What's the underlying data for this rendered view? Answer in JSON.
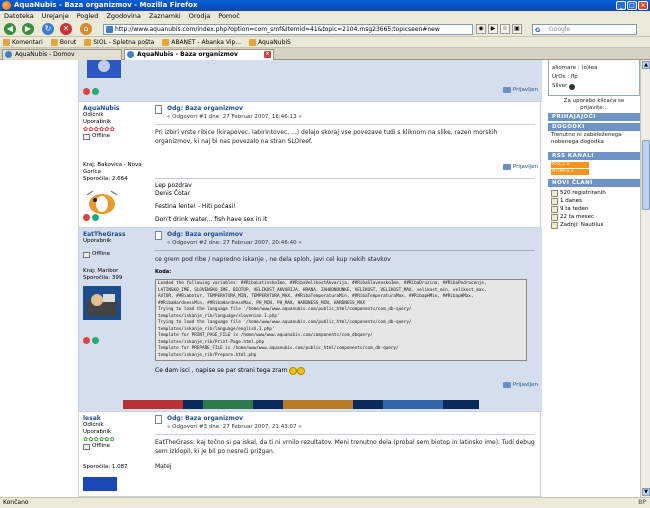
{
  "window": {
    "title": "AquaNubis - Baza organizmov - Mozilla Firefox"
  },
  "menubar": [
    "Datoteka",
    "Urejanje",
    "Pogled",
    "Zgodovina",
    "Zaznamki",
    "Orodja",
    "Pomoč"
  ],
  "navbar": {
    "url": "http://www.aquanubis.com/index.php?option=com_smf&Itemid=41&topic=2104.msg23665;topicseen#new",
    "search_placeholder": "Google",
    "search_logo": "G"
  },
  "bookmarks": [
    "Komentari",
    "Borut",
    "SIOL - Spletna pošta",
    "ABANET - Abanka Vip...",
    "AquaNubiS"
  ],
  "tabs": [
    {
      "label": "AquaNubis - Domov"
    },
    {
      "label": "AquaNubis - Baza organizmov"
    }
  ],
  "posts": [
    {
      "reply": "Prijavljen"
    },
    {
      "user": "AquaNubis",
      "rank": "Odičnik",
      "role": "Uporabnik",
      "stars": "✿✿✿✿✿✿",
      "status": "Offline",
      "location": "Kraj: Bakovica - Nova Gorica",
      "messages": "Sporočila: 2.664",
      "title": "Odg: Baza organizmov",
      "meta": "« Odgovori #1 dne: 27 Februar 2007, 16:46:13 »",
      "text": "Pri izbiri vrste ribice (kirapovec, labirintovec, ...) delajo skoraj vse povezave tudi s kliknom na slike, razen morskih organizmov, ki naj bi nas povezalo na stran SLOreef.",
      "sig1": "Lep pozdrav",
      "sig2": "Denis Čotar",
      "sig3": "Festina lente! - Hiti počasi!",
      "sig4": "Don't drink water... fish have sex in it",
      "reply": "Prijavljen"
    },
    {
      "user": "EatTheGrass",
      "role": "Uporabnik",
      "status": "Offline",
      "location": "Kraj: Maribor",
      "messages": "Sporočila: 399",
      "title": "Odg: Baza organizmov",
      "meta": "« Odgovori #2 dne: 27 Februar 2007, 20:46:40 »",
      "text": "ce grem pod ribe / napredno iskanje , ne dela sploh, javi cel kup nekih stavkov",
      "code_label": "Koda:",
      "code": "Loaded the following variables: ##RibaLatinskoIme, ##RibaVelikostAkvarija, ##RibaSlovenskoIme, ##RibaDruzina, ##RibaPodrocenje,\nLATINSKO_IME, SLOVENSKO_IME, BIOTOP, VELIKOST_AKVARIJA, HRANA, ZAHODNOUNKE, VELIKOST, VELIKOST_MAX, velikost_min, velikost_max,\nAVTOR, ##Biabotor, TEMPERATURA_MIN, TEMPERATURA_MAX, ##RibaTemperaturaMin, ##RibaTemperaturaMax, ##RibapHMin, ##RibapHMax,\n##RibaHardnessMin, ##RibaHardnessMax, PH_MIN, PH_MAX, HARDNESS_MIN, HARDNESS_MAX\nTrying to load the language file '/home/www/www.aquanubis.com/public_html/components/com_db-query/\ntemplates/iskanje_rib/language/slovenian.1.php'\nTrying to load the language file '/home/www/www.aquanubis.com/public_html/components/com_db-query/\ntemplates/iskanje_rib/language/english.1.php'\nTemplate for PRINT_PAGE_FILE is /home/www/www.aquanubis.com/components/com_dbquery/\ntemplates/iskanje_rib/Print-Page.html.php\nTemplate for PREPARE_FILE is /home/www/www.aquanubis.com/public_html/components/com_db-query/\ntemplates/iskanje_rib/Prepare.html.php",
      "closing": "Ce dam isci , napise se par strani tega zram",
      "reply": "Prijavljen"
    },
    {
      "user": "lesak",
      "rank": "Odičnik",
      "role": "Uporabnik",
      "stars": "✿✿✿✿✿✿",
      "status": "Offline",
      "messages": "Sporočila: 1.087",
      "title": "Odg: Baza organizmov",
      "meta": "« Odgovori #3 dne: 27 Februar 2007, 21:43:07 »",
      "text": "EatTheGrass: kaj točno si pa iskal, da ti ni vrnilo rezultatov. Meni trenutno dela (probal sem biotop in latinsko ime). Tudi debug sem izklopil, ki je bil po nesreči prižgan.",
      "sig": "Matej"
    }
  ],
  "right": {
    "top_lines": [
      "aliomare : (o)lea",
      "UrOs : flp",
      "Silver"
    ],
    "login_label": "Za uporabo klicaća se prijavite...",
    "online_header": "PRIHAJAJOČI",
    "events_header": "DOGODKI",
    "events_text": "Trenutno ni zabeleženega nobenega dogodka",
    "rss_header": "RSS KANALI",
    "rss_items": [
      "RSS 2.0",
      "ATOM 0.3"
    ],
    "members_header": "NOVI ČLANI",
    "members": [
      "520 registriranih",
      "1 danes",
      "9 ta teden",
      "22 ta mesec",
      "Zadnji: Nautilus"
    ]
  },
  "status": {
    "text": "Končano",
    "right": "BP"
  }
}
